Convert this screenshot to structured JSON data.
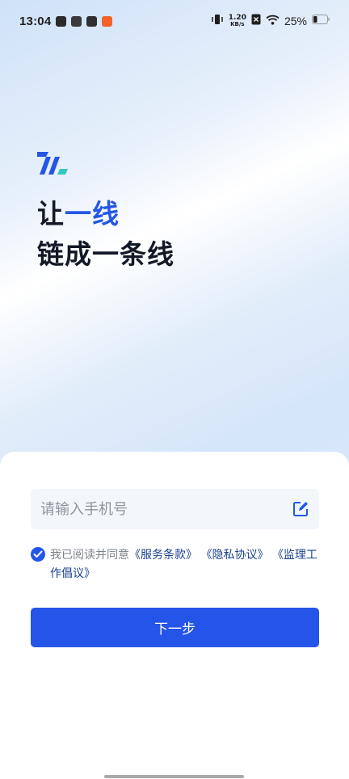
{
  "status_bar": {
    "time": "13:04",
    "net_speed_value": "1.20",
    "net_speed_unit": "KB/s",
    "battery_percent": "25%",
    "icons": [
      "app-notification-icon",
      "app-notification-icon",
      "app-notification-icon",
      "vibrate-icon",
      "sim-off-icon",
      "wifi-icon",
      "battery-icon"
    ]
  },
  "hero": {
    "line1_plain": "让",
    "line1_accent": "一线",
    "line2": "链成一条线",
    "accent_color": "#2456e6",
    "logo_icon": "brand-logo-icon"
  },
  "login": {
    "phone_placeholder": "请输入手机号",
    "phone_value": "",
    "edit_icon": "edit-icon",
    "agree_prefix": "我已阅读并同意",
    "terms_link": "《服务条款》",
    "privacy_link": "《隐私协议》",
    "conduct_link": "《监理工作倡议》",
    "agree_checked": true,
    "next_button": "下一步",
    "button_color": "#2455e8"
  }
}
